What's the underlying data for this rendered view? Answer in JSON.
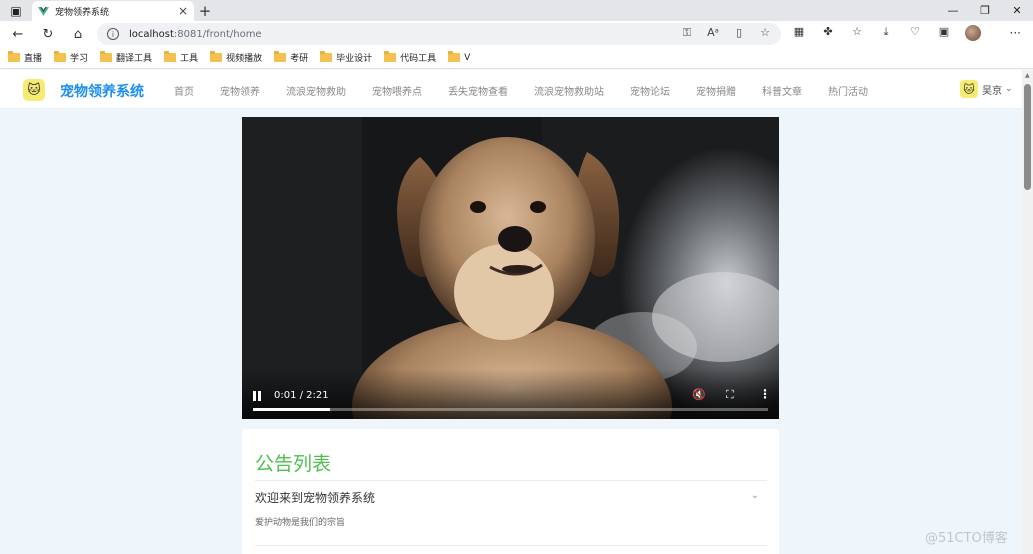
{
  "browser": {
    "tab_title": "宠物领养系统",
    "url_host": "localhost",
    "url_path": ":8081/front/home",
    "bookmarks": [
      "直播",
      "学习",
      "翻译工具",
      "工具",
      "视频播放",
      "考研",
      "毕业设计",
      "代码工具",
      "V"
    ]
  },
  "site": {
    "brand": "宠物领养系统",
    "nav": [
      "首页",
      "宠物领养",
      "流浪宠物救助",
      "宠物喂养点",
      "丢失宠物查看",
      "流浪宠物救助站",
      "宠物论坛",
      "宠物捐赠",
      "科普文章",
      "热门活动"
    ],
    "user_name": "吴京"
  },
  "video": {
    "time_display": "0:01 / 2:21",
    "progress_fraction": 0.15,
    "muted": true
  },
  "notices": {
    "title": "公告列表",
    "items": [
      {
        "title": "欢迎来到宠物领养系统",
        "body": "爱护动物是我们的宗旨"
      }
    ]
  },
  "watermark": "@51CTO博客",
  "colors": {
    "brand_blue": "#1d8ef0",
    "notice_green": "#4fbf4f",
    "page_bg": "#eef6fc"
  }
}
